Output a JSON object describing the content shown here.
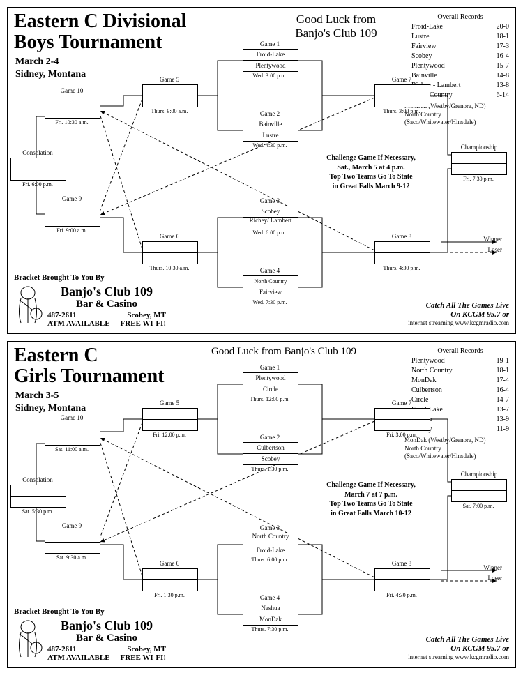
{
  "boys": {
    "title1": "Eastern C Divisional",
    "title2": "Boys Tournament",
    "dates": "March 2-4",
    "location": "Sidney, Montana",
    "goodluck1": "Good Luck from",
    "goodluck2": "Banjo's Club 109",
    "records_header": "Overall Records",
    "records": [
      {
        "team": "Froid-Lake",
        "rec": "20-0"
      },
      {
        "team": "Lustre",
        "rec": "18-1"
      },
      {
        "team": "Fairview",
        "rec": "17-3"
      },
      {
        "team": "Scobey",
        "rec": "16-4"
      },
      {
        "team": "Plentywood",
        "rec": "15-7"
      },
      {
        "team": "Bainville",
        "rec": "14-8"
      },
      {
        "team": "Richey - Lambert",
        "rec": "13-8"
      },
      {
        "team": "North Country",
        "rec": "6-14"
      }
    ],
    "notes": "MonDak (Westby/Grenora, ND)\nNorth Country (Saco/Whitewater/Hinsdale)",
    "challenge": "Challenge Game If Necessary,\nSat., March 5 at 4 p.m.\nTop Two Teams Go To State\nin Great Falls March 9-12",
    "games": {
      "g1": {
        "label": "Game 1",
        "time": "Wed. 3:00 p.m.",
        "a": "Froid-Lake",
        "b": "Plentywood"
      },
      "g2": {
        "label": "Game 2",
        "time": "Wed. 4:30 p.m.",
        "a": "Bainville",
        "b": "Lustre"
      },
      "g3": {
        "label": "Game 3",
        "time": "Wed. 6:00 p.m.",
        "a": "Scobey",
        "b": "Richey/\nLambert"
      },
      "g4": {
        "label": "Game 4",
        "time": "Wed. 7:30 p.m.",
        "a": "North Country",
        "b": "Fairview"
      },
      "g5": {
        "label": "Game 5",
        "time": "Thurs. 9:00 a.m."
      },
      "g6": {
        "label": "Game 6",
        "time": "Thurs. 10:30 a.m."
      },
      "g7": {
        "label": "Game 7",
        "time": "Thurs. 3:00 p.m."
      },
      "g8": {
        "label": "Game 8",
        "time": "Thurs. 4:30 p.m."
      },
      "g9": {
        "label": "Game 9",
        "time": "Fri. 9:00 a.m."
      },
      "g10": {
        "label": "Game 10",
        "time": "Fri. 10:30 a.m."
      },
      "cons": {
        "label": "Consolation",
        "time": "Fri. 6:00 p.m."
      },
      "champ": {
        "label": "Championship",
        "time": "Fri. 7:30 p.m."
      }
    },
    "legend": {
      "winner": "Winner",
      "loser": "Loser"
    }
  },
  "girls": {
    "title1": "Eastern C",
    "title2": "Girls Tournament",
    "dates": "March 3-5",
    "location": "Sidney, Montana",
    "goodluck": "Good Luck from Banjo's Club 109",
    "records_header": "Overall Records",
    "records": [
      {
        "team": "Plentywood",
        "rec": "19-1"
      },
      {
        "team": "North Country",
        "rec": "18-1"
      },
      {
        "team": "MonDak",
        "rec": "17-4"
      },
      {
        "team": "Culbertson",
        "rec": "16-4"
      },
      {
        "team": "Circle",
        "rec": "14-7"
      },
      {
        "team": "Froid-Lake",
        "rec": "13-7"
      },
      {
        "team": "Nashua",
        "rec": "13-9"
      },
      {
        "team": "Scobey",
        "rec": "11-9"
      }
    ],
    "notes": "MonDak (Westby/Grenora, ND)\nNorth Country (Saco/Whitewater/Hinsdale)",
    "challenge": "Challenge Game If Necessary,\nMarch 7 at 7 p.m.\nTop Two Teams Go To State\nin Great Falls March 10-12",
    "games": {
      "g1": {
        "label": "Game 1",
        "time": "Thurs. 12:00 p.m.",
        "a": "Plentywood",
        "b": "Circle"
      },
      "g2": {
        "label": "Game 2",
        "time": "Thurs. 1:30 p.m.",
        "a": "Culbertson",
        "b": "Scobey"
      },
      "g3": {
        "label": "Game 3",
        "time": "Thurs. 6:00 p.m.",
        "a": "North\nCountry",
        "b": "Froid-Lake"
      },
      "g4": {
        "label": "Game 4",
        "time": "Thurs. 7:30 p.m.",
        "a": "Nashua",
        "b": "MonDak"
      },
      "g5": {
        "label": "Game 5",
        "time": "Fri. 12:00 p.m."
      },
      "g6": {
        "label": "Game 6",
        "time": "Fri. 1:30 p.m."
      },
      "g7": {
        "label": "Game 7",
        "time": "Fri. 3:00 p.m."
      },
      "g8": {
        "label": "Game 8",
        "time": "Fri. 4:30 p.m."
      },
      "g9": {
        "label": "Game 9",
        "time": "Sat. 9:30 a.m."
      },
      "g10": {
        "label": "Game 10",
        "time": "Sat. 11:00 a.m."
      },
      "cons": {
        "label": "Consolation",
        "time": "Sat. 5:30 p.m."
      },
      "champ": {
        "label": "Championship",
        "time": "Sat. 7:00 p.m."
      }
    },
    "legend": {
      "winner": "Winner",
      "loser": "Loser"
    }
  },
  "sponsor": {
    "header": "Bracket Brought To You By",
    "name": "Banjo's Club 109",
    "sub": "Bar & Casino",
    "phone": "487-2611",
    "city": "Scobey, MT",
    "atm": "ATM AVAILABLE",
    "wifi": "FREE  WI-FI!"
  },
  "catch": {
    "l1": "Catch All The Games Live",
    "l2": "On KCGM 95.7 or",
    "l3": "internet streaming  www.kcgmradio.com"
  }
}
